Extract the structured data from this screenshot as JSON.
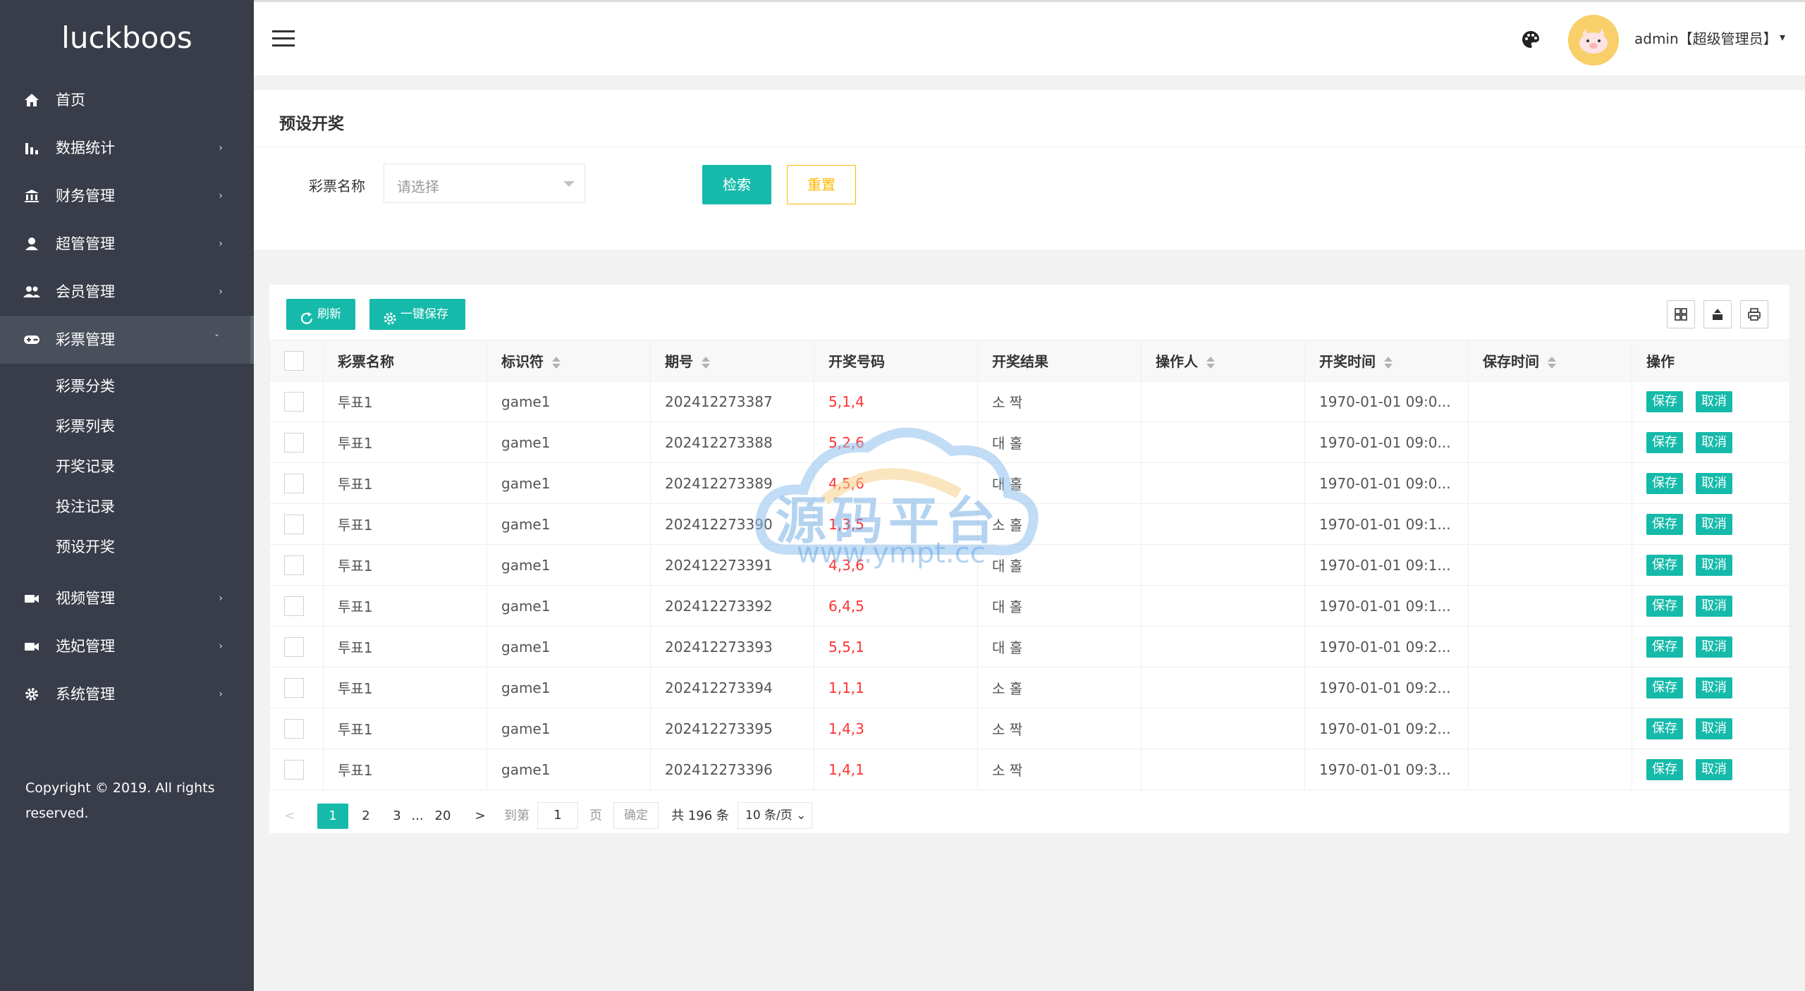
{
  "app": {
    "logo": "luckboos"
  },
  "sidebar": {
    "items": [
      {
        "label": "首页",
        "icon": "home-icon",
        "has_arrow": false
      },
      {
        "label": "数据统计",
        "icon": "bar-chart-icon",
        "has_arrow": true
      },
      {
        "label": "财务管理",
        "icon": "bank-icon",
        "has_arrow": true
      },
      {
        "label": "超管管理",
        "icon": "user-icon",
        "has_arrow": true
      },
      {
        "label": "会员管理",
        "icon": "users-icon",
        "has_arrow": true
      },
      {
        "label": "彩票管理",
        "icon": "gamepad-icon",
        "has_arrow": true,
        "expanded": true
      }
    ],
    "sub_items": [
      "彩票分类",
      "彩票列表",
      "开奖记录",
      "投注记录",
      "预设开奖"
    ],
    "items_after": [
      {
        "label": "视频管理",
        "icon": "video-icon",
        "has_arrow": true
      },
      {
        "label": "选妃管理",
        "icon": "video-icon",
        "has_arrow": true
      },
      {
        "label": "系统管理",
        "icon": "gear-icon",
        "has_arrow": true
      }
    ],
    "copyright": "Copyright © 2019. All rights reserved."
  },
  "header": {
    "user_label": "admin【超级管理员】"
  },
  "search": {
    "title": "预设开奖",
    "field_label": "彩票名称",
    "select_placeholder": "请选择",
    "search_button": "检索",
    "reset_button": "重置"
  },
  "toolbar": {
    "refresh": "刷新",
    "save_all": "一键保存"
  },
  "table": {
    "columns": [
      "彩票名称",
      "标识符",
      "期号",
      "开奖号码",
      "开奖结果",
      "操作人",
      "开奖时间",
      "保存时间",
      "操作"
    ],
    "save_label": "保存",
    "cancel_label": "取消",
    "rows": [
      {
        "name": "투표1",
        "code": "game1",
        "issue": "202412273387",
        "numbers": "5,1,4",
        "result": "소 짝",
        "operator": "",
        "time": "1970-01-01 09:0...",
        "save_time": ""
      },
      {
        "name": "투표1",
        "code": "game1",
        "issue": "202412273388",
        "numbers": "5,2,6",
        "result": "대 홀",
        "operator": "",
        "time": "1970-01-01 09:0...",
        "save_time": ""
      },
      {
        "name": "투표1",
        "code": "game1",
        "issue": "202412273389",
        "numbers": "4,5,6",
        "result": "대 홀",
        "operator": "",
        "time": "1970-01-01 09:0...",
        "save_time": ""
      },
      {
        "name": "투표1",
        "code": "game1",
        "issue": "202412273390",
        "numbers": "1,3,5",
        "result": "소 홀",
        "operator": "",
        "time": "1970-01-01 09:1...",
        "save_time": ""
      },
      {
        "name": "투표1",
        "code": "game1",
        "issue": "202412273391",
        "numbers": "4,3,6",
        "result": "대 홀",
        "operator": "",
        "time": "1970-01-01 09:1...",
        "save_time": ""
      },
      {
        "name": "투표1",
        "code": "game1",
        "issue": "202412273392",
        "numbers": "6,4,5",
        "result": "대 홀",
        "operator": "",
        "time": "1970-01-01 09:1...",
        "save_time": ""
      },
      {
        "name": "투표1",
        "code": "game1",
        "issue": "202412273393",
        "numbers": "5,5,1",
        "result": "대 홀",
        "operator": "",
        "time": "1970-01-01 09:2...",
        "save_time": ""
      },
      {
        "name": "투표1",
        "code": "game1",
        "issue": "202412273394",
        "numbers": "1,1,1",
        "result": "소 홀",
        "operator": "",
        "time": "1970-01-01 09:2...",
        "save_time": ""
      },
      {
        "name": "투표1",
        "code": "game1",
        "issue": "202412273395",
        "numbers": "1,4,3",
        "result": "소 짝",
        "operator": "",
        "time": "1970-01-01 09:2...",
        "save_time": ""
      },
      {
        "name": "투표1",
        "code": "game1",
        "issue": "202412273396",
        "numbers": "1,4,1",
        "result": "소 짝",
        "operator": "",
        "time": "1970-01-01 09:3...",
        "save_time": ""
      }
    ]
  },
  "pager": {
    "prev": "<",
    "pages": [
      "1",
      "2",
      "3"
    ],
    "ellipsis": "...",
    "last_page": "20",
    "next": ">",
    "goto_label": "到第",
    "goto_value": "1",
    "page_unit": "页",
    "confirm": "确定",
    "total": "共 196 条",
    "page_size": "10 条/页"
  },
  "watermark": {
    "text": "源码平台",
    "url": "www.ympt.cc"
  },
  "colors": {
    "sidebar_bg": "#393d49",
    "accent": "#16baaa",
    "warn": "#ffb800",
    "red": "#ff3232"
  }
}
